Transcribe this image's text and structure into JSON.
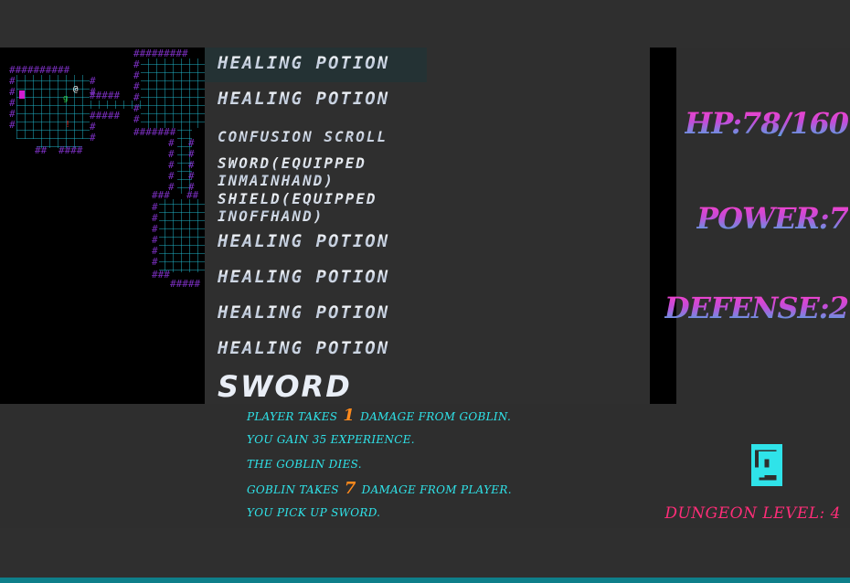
{
  "inventory": {
    "items": [
      "Healing Potion",
      "Healing Potion",
      "Confusion Scroll",
      "Sword(equipped\ninmainhand)",
      "Shield(equipped\ninoffhand)",
      "Healing Potion",
      "Healing Potion",
      "Healing Potion",
      "Healing Potion"
    ],
    "selected_title": "Sword"
  },
  "stats": {
    "hp": "HP:78/160",
    "power": "POWER:7",
    "defense": "DEFENSE:2"
  },
  "log": {
    "line1_pre": "Player takes",
    "line1_num": "1",
    "line1_post": "damage from Goblin.",
    "line2": "You gain 35 experience.",
    "line3": "The Goblin dies.",
    "line4_pre": "Goblin takes",
    "line4_num": "7",
    "line4_post": "damage from Player.",
    "line5": "You pick up Sword."
  },
  "dungeon_level": "Dungeon level: 4",
  "map": {
    "player_glyph": "@",
    "item_glyph": "!",
    "enemy_glyph": "g"
  },
  "colors": {
    "wall": "#7a2fbf",
    "floor_grid": "#1fb5c9",
    "log_text": "#2fe3e9",
    "log_number": "#ff8a1c",
    "dungeon_level": "#ff2d78",
    "stat_gradient_top": "#ff3fc6",
    "stat_gradient_bottom": "#3bb7e4"
  }
}
